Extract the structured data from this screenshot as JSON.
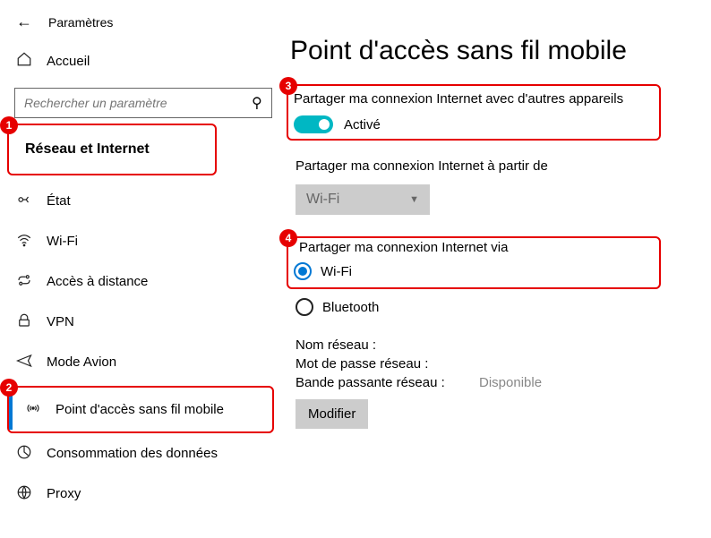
{
  "app": {
    "title": "Paramètres"
  },
  "search": {
    "placeholder": "Rechercher un paramètre"
  },
  "sidebar": {
    "home": "Accueil",
    "section": "Réseau et Internet",
    "items": [
      {
        "icon": "status",
        "label": "État"
      },
      {
        "icon": "wifi",
        "label": "Wi-Fi"
      },
      {
        "icon": "remote",
        "label": "Accès à distance"
      },
      {
        "icon": "vpn",
        "label": "VPN"
      },
      {
        "icon": "airplane",
        "label": "Mode Avion"
      },
      {
        "icon": "hotspot",
        "label": "Point d'accès sans fil mobile"
      },
      {
        "icon": "data",
        "label": "Consommation des données"
      },
      {
        "icon": "proxy",
        "label": "Proxy"
      }
    ]
  },
  "page": {
    "title": "Point d'accès sans fil mobile",
    "share_label": "Partager ma connexion Internet avec d'autres appareils",
    "toggle_state": "Activé",
    "share_from_label": "Partager ma connexion Internet à partir de",
    "share_from_value": "Wi-Fi",
    "share_via_label": "Partager ma connexion Internet via",
    "via_options": [
      {
        "label": "Wi-Fi",
        "selected": true
      },
      {
        "label": "Bluetooth",
        "selected": false
      }
    ],
    "info": {
      "net_name_key": "Nom réseau :",
      "net_name_val": "",
      "net_pass_key": "Mot de passe réseau :",
      "net_pass_val": "",
      "band_key": "Bande passante réseau :",
      "band_val": "Disponible"
    },
    "edit_btn": "Modifier"
  },
  "markers": {
    "m1": "1",
    "m2": "2",
    "m3": "3",
    "m4": "4"
  }
}
